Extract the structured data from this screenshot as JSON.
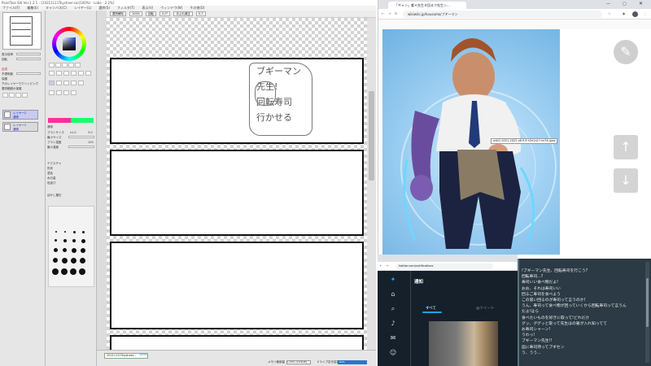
{
  "sai": {
    "title": "PaintTool SAI Ver.1.2.5 - [20211111Toysheer.sai(100%) - Lobo - 2.2%]",
    "menu": [
      "ファイル(F)",
      "編集(E)",
      "キャンバス(C)",
      "レイヤー(L)",
      "選択(S)",
      "フィルタ(T)",
      "表示(V)",
      "ウィンドウ(W)",
      "その他(O)"
    ],
    "toolbar": {
      "selection_label": "選択解除",
      "zoom_value": "100%",
      "zoom_label": "回転",
      "rotate_value": "0.0°",
      "stab_label": "手ぶれ補正",
      "stab_value": "S-7"
    },
    "left_labels": [
      "表示倍率",
      "回転",
      "不透明度",
      "合成",
      "保護",
      "下のレイヤーでクリッピング",
      "選択範囲の保護",
      "不透明度保護",
      "全てのレイヤー"
    ],
    "blend_mode": "通常",
    "opacity_value": "100%",
    "layers": [
      {
        "name": "レイヤー2",
        "sub": "通常"
      },
      {
        "name": "レイヤー1",
        "sub": "通常"
      }
    ],
    "mid_labels": [
      "通常",
      "ブラシサイズ",
      "最小サイズ",
      "ブラシ濃度",
      "最小濃度",
      "テクスチャ",
      "形状",
      "混色",
      "水分量",
      "色延び",
      "ぼかし筆圧"
    ],
    "brush_size": "x1.0",
    "brush_size_value": "3.0",
    "brush_density": "100",
    "status_file": "20211111Toysheer...",
    "status_zoom": "100%",
    "memory_label": "メモリ使用量",
    "memory_value": "1.03% (10.8GB)",
    "drive_label": "ドライブ空き容量",
    "drive_value": "84%"
  },
  "canvas_note": {
    "lines": [
      "ブギーマン",
      "先生!",
      "回転寿司",
      "行かせる"
    ]
  },
  "chrome1": {
    "tab_title": "「ギャン」紫＊先生タ回るフ先生ン...",
    "url": "wikiwiki.jp/housamo/ブギーマン",
    "tooltip": "wiki1-2021-2022-v8.9.6 h2e1a2+nn3X.jpeg"
  },
  "chrome2": {
    "url": "twitter.com/notifications",
    "heading": "通知",
    "tab_all": "すべて",
    "tab_mention": "@ツイート"
  },
  "chat": {
    "lines": [
      "!ブギーマン先生、回転寿司を行こう?",
      "回転寿司...?",
      "寿司いい食べ物だよ!",
      "おお、それは寿司いい",
      "回るご寿司を食べよう",
      "この思い回るのが寿司って言うのか!",
      "うん、寿司って食べ物が回っていくから回転寿司って言うん",
      "だよ!ほら",
      "食べたいものを好きに取って!どれだけ",
      "グッ、ググッと取って先生はの箸が入れ知ってて",
      "お寿司シャーン!",
      "うわっ!",
      "ブギーマン先生!!",
      "皿に寿司持ってブギセン",
      "う、うう..."
    ]
  },
  "icons": {
    "edit": "pencil-icon",
    "up": "arrow-up-icon",
    "down": "arrow-down-icon"
  }
}
